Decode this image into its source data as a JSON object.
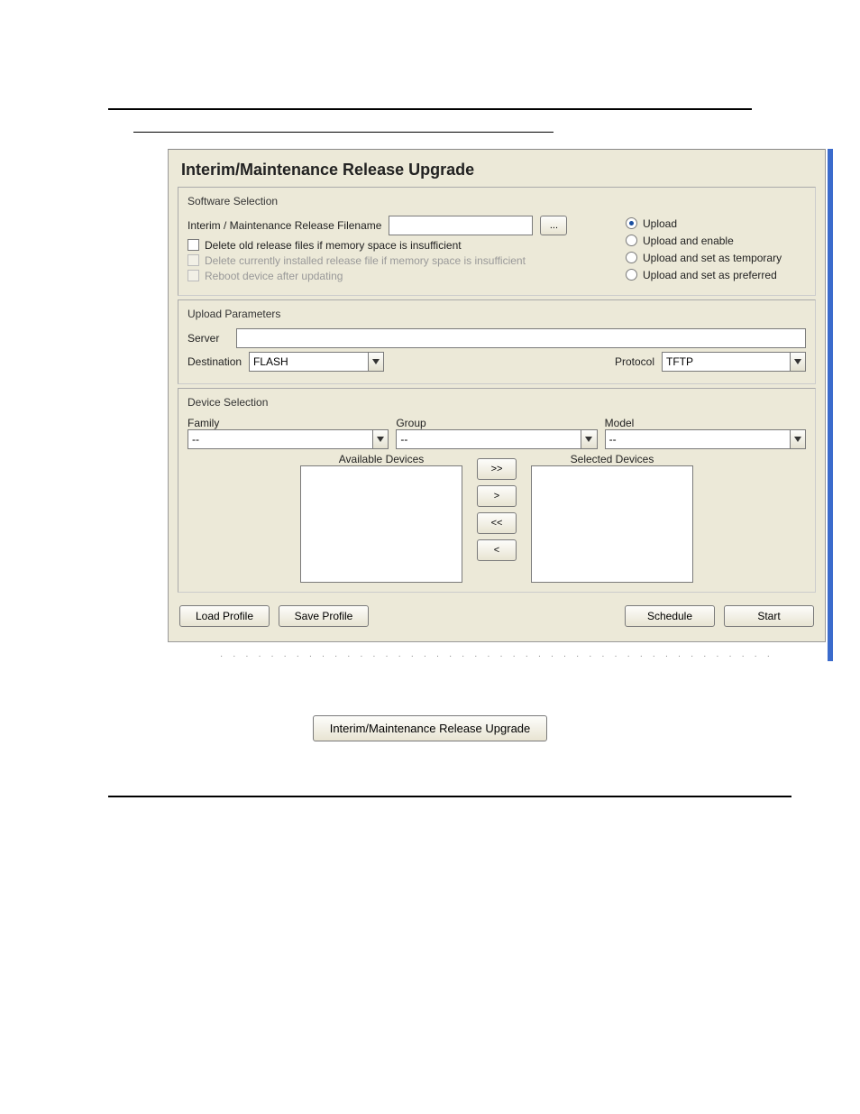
{
  "title": "Interim/Maintenance Release Upgrade",
  "software_selection": {
    "legend": "Software Selection",
    "filename_label": "Interim / Maintenance Release Filename",
    "filename_value": "",
    "browse_label": "...",
    "checkboxes": {
      "delete_old": "Delete old release files if memory space is insufficient",
      "delete_current": "Delete currently installed release file if memory space is insufficient",
      "reboot": "Reboot device after updating"
    },
    "radios": {
      "upload": "Upload",
      "upload_enable": "Upload and enable",
      "upload_temp": "Upload and set as temporary",
      "upload_pref": "Upload and set as preferred"
    }
  },
  "upload_params": {
    "legend": "Upload Parameters",
    "server_label": "Server",
    "server_value": "",
    "destination_label": "Destination",
    "destination_value": "FLASH",
    "protocol_label": "Protocol",
    "protocol_value": "TFTP"
  },
  "device_selection": {
    "legend": "Device Selection",
    "family_label": "Family",
    "family_value": "--",
    "group_label": "Group",
    "group_value": "--",
    "model_label": "Model",
    "model_value": "--",
    "available_label": "Available Devices",
    "selected_label": "Selected Devices",
    "btn_all_right": ">>",
    "btn_right": ">",
    "btn_all_left": "<<",
    "btn_left": "<"
  },
  "buttons": {
    "load_profile": "Load Profile",
    "save_profile": "Save Profile",
    "schedule": "Schedule",
    "start": "Start"
  },
  "nav_button": "Interim/Maintenance Release Upgrade"
}
